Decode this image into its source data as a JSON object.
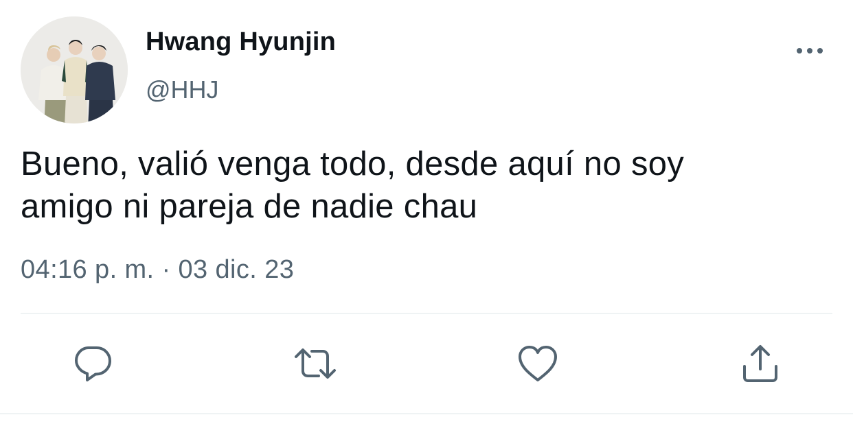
{
  "tweet": {
    "author_name": "Hwang Hyunjin",
    "author_handle": "@HHJ",
    "text_line1": "Bueno, valió venga todo, desde aquí no soy",
    "text_line2": "amigo ni pareja de nadie chau",
    "timestamp": "04:16 p. m. · 03 dic. 23",
    "avatar_icon": "profile-photo",
    "more_icon": "more-horizontal-icon"
  },
  "actions": [
    {
      "icon": "reply-icon"
    },
    {
      "icon": "retweet-icon"
    },
    {
      "icon": "like-icon"
    },
    {
      "icon": "share-icon"
    }
  ],
  "colors": {
    "text_primary": "#0f1419",
    "text_secondary": "#536471",
    "icon": "#536471",
    "divider": "#eff3f4"
  }
}
